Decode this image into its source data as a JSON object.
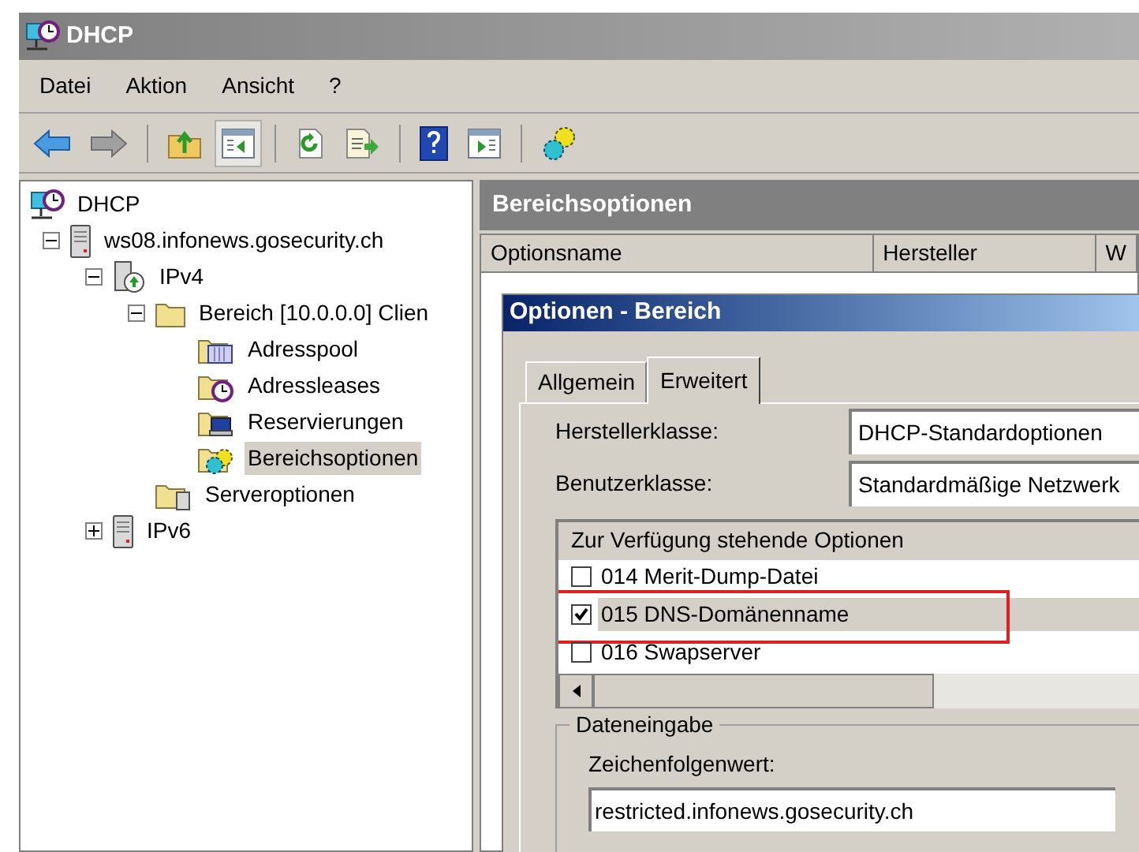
{
  "window": {
    "title": "DHCP"
  },
  "menu": [
    "Datei",
    "Aktion",
    "Ansicht",
    "?"
  ],
  "toolbar": [
    {
      "kind": "back",
      "pressed": false
    },
    {
      "kind": "forward",
      "pressed": false
    },
    {
      "kind": "sep"
    },
    {
      "kind": "up",
      "pressed": false
    },
    {
      "kind": "tree",
      "pressed": true
    },
    {
      "kind": "sep"
    },
    {
      "kind": "refresh",
      "pressed": false
    },
    {
      "kind": "export",
      "pressed": false
    },
    {
      "kind": "sep"
    },
    {
      "kind": "help",
      "pressed": false
    },
    {
      "kind": "pane",
      "pressed": false
    },
    {
      "kind": "sep"
    },
    {
      "kind": "gears",
      "pressed": false
    }
  ],
  "tree": {
    "label": "DHCP",
    "kind": "dhcp",
    "selected": false,
    "children": [
      {
        "label": "ws08.infonews.gosecurity.ch",
        "kind": "server",
        "expanded": true,
        "selected": false,
        "children": [
          {
            "label": "IPv4",
            "kind": "ipv4",
            "expanded": true,
            "selected": false,
            "children": [
              {
                "label": "Bereich [10.0.0.0] Clien",
                "kind": "folder",
                "expanded": true,
                "selected": false,
                "children": [
                  {
                    "label": "Adresspool",
                    "kind": "pool",
                    "selected": false
                  },
                  {
                    "label": "Adressleases",
                    "kind": "leases",
                    "selected": false
                  },
                  {
                    "label": "Reservierungen",
                    "kind": "reservations",
                    "selected": false
                  },
                  {
                    "label": "Bereichsoptionen",
                    "kind": "options",
                    "selected": true
                  }
                ]
              },
              {
                "label": "Serveroptionen",
                "kind": "serveroptions",
                "selected": false
              }
            ]
          },
          {
            "label": "IPv6",
            "kind": "server",
            "expanded": false,
            "selected": false
          }
        ]
      }
    ]
  },
  "panel": {
    "title": "Bereichsoptionen",
    "columns": [
      "Optionsname",
      "Hersteller",
      "W"
    ]
  },
  "dialog": {
    "title": "Optionen - Bereich",
    "tabs": [
      {
        "label": "Allgemein",
        "selected": false
      },
      {
        "label": "Erweitert",
        "selected": true
      }
    ],
    "vendor_class": {
      "label": "Herstellerklasse:",
      "value": "DHCP-Standardoptionen"
    },
    "user_class": {
      "label": "Benutzerklasse:",
      "value": "Standardmäßige Netzwerk"
    },
    "options": {
      "heading": "Zur Verfügung stehende Optionen",
      "items": [
        {
          "label": "014 Merit-Dump-Datei",
          "checked": false,
          "selected": false,
          "annotated": false
        },
        {
          "label": "015 DNS-Domänenname",
          "checked": true,
          "selected": true,
          "annotated": true
        },
        {
          "label": "016 Swapserver",
          "checked": false,
          "selected": false,
          "annotated": false
        }
      ]
    },
    "data_entry": {
      "title": "Dateneingabe",
      "label": "Zeichenfolgenwert:",
      "value": "restricted.infonews.gosecurity.ch"
    }
  }
}
